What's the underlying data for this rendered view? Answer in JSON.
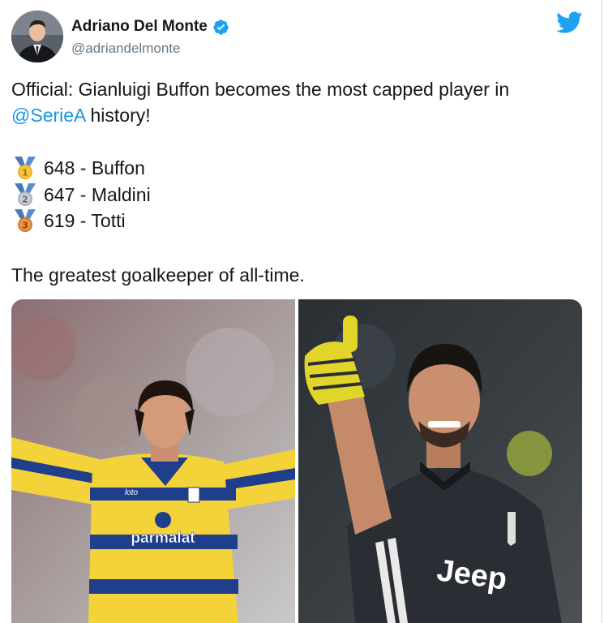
{
  "author": {
    "display_name": "Adriano Del Monte",
    "handle": "@adriandelmonte",
    "verified": true
  },
  "brand": {
    "logo": "twitter-bird-icon",
    "color": "#1da1f2"
  },
  "tweet": {
    "line1": "Official: Gianluigi Buffon becomes the most capped player in",
    "line2_mention": "@SerieA",
    "line2_rest": " history!",
    "rankings": [
      {
        "medal": "gold-medal-icon",
        "medal_number": "1",
        "text": "648 - Buffon"
      },
      {
        "medal": "silver-medal-icon",
        "medal_number": "2",
        "text": "647 - Maldini"
      },
      {
        "medal": "bronze-medal-icon",
        "medal_number": "3",
        "text": "619 - Totti"
      }
    ],
    "closing": "The greatest goalkeeper of all-time."
  },
  "media": {
    "left_photo": {
      "jersey_sponsor": "parmalat",
      "kit_brand": "loto"
    },
    "right_photo": {
      "jersey_sponsor": "Jeep"
    }
  },
  "colors": {
    "text": "#14171a",
    "secondary": "#657786",
    "link": "#1b95e0",
    "verified": "#1da1f2"
  }
}
